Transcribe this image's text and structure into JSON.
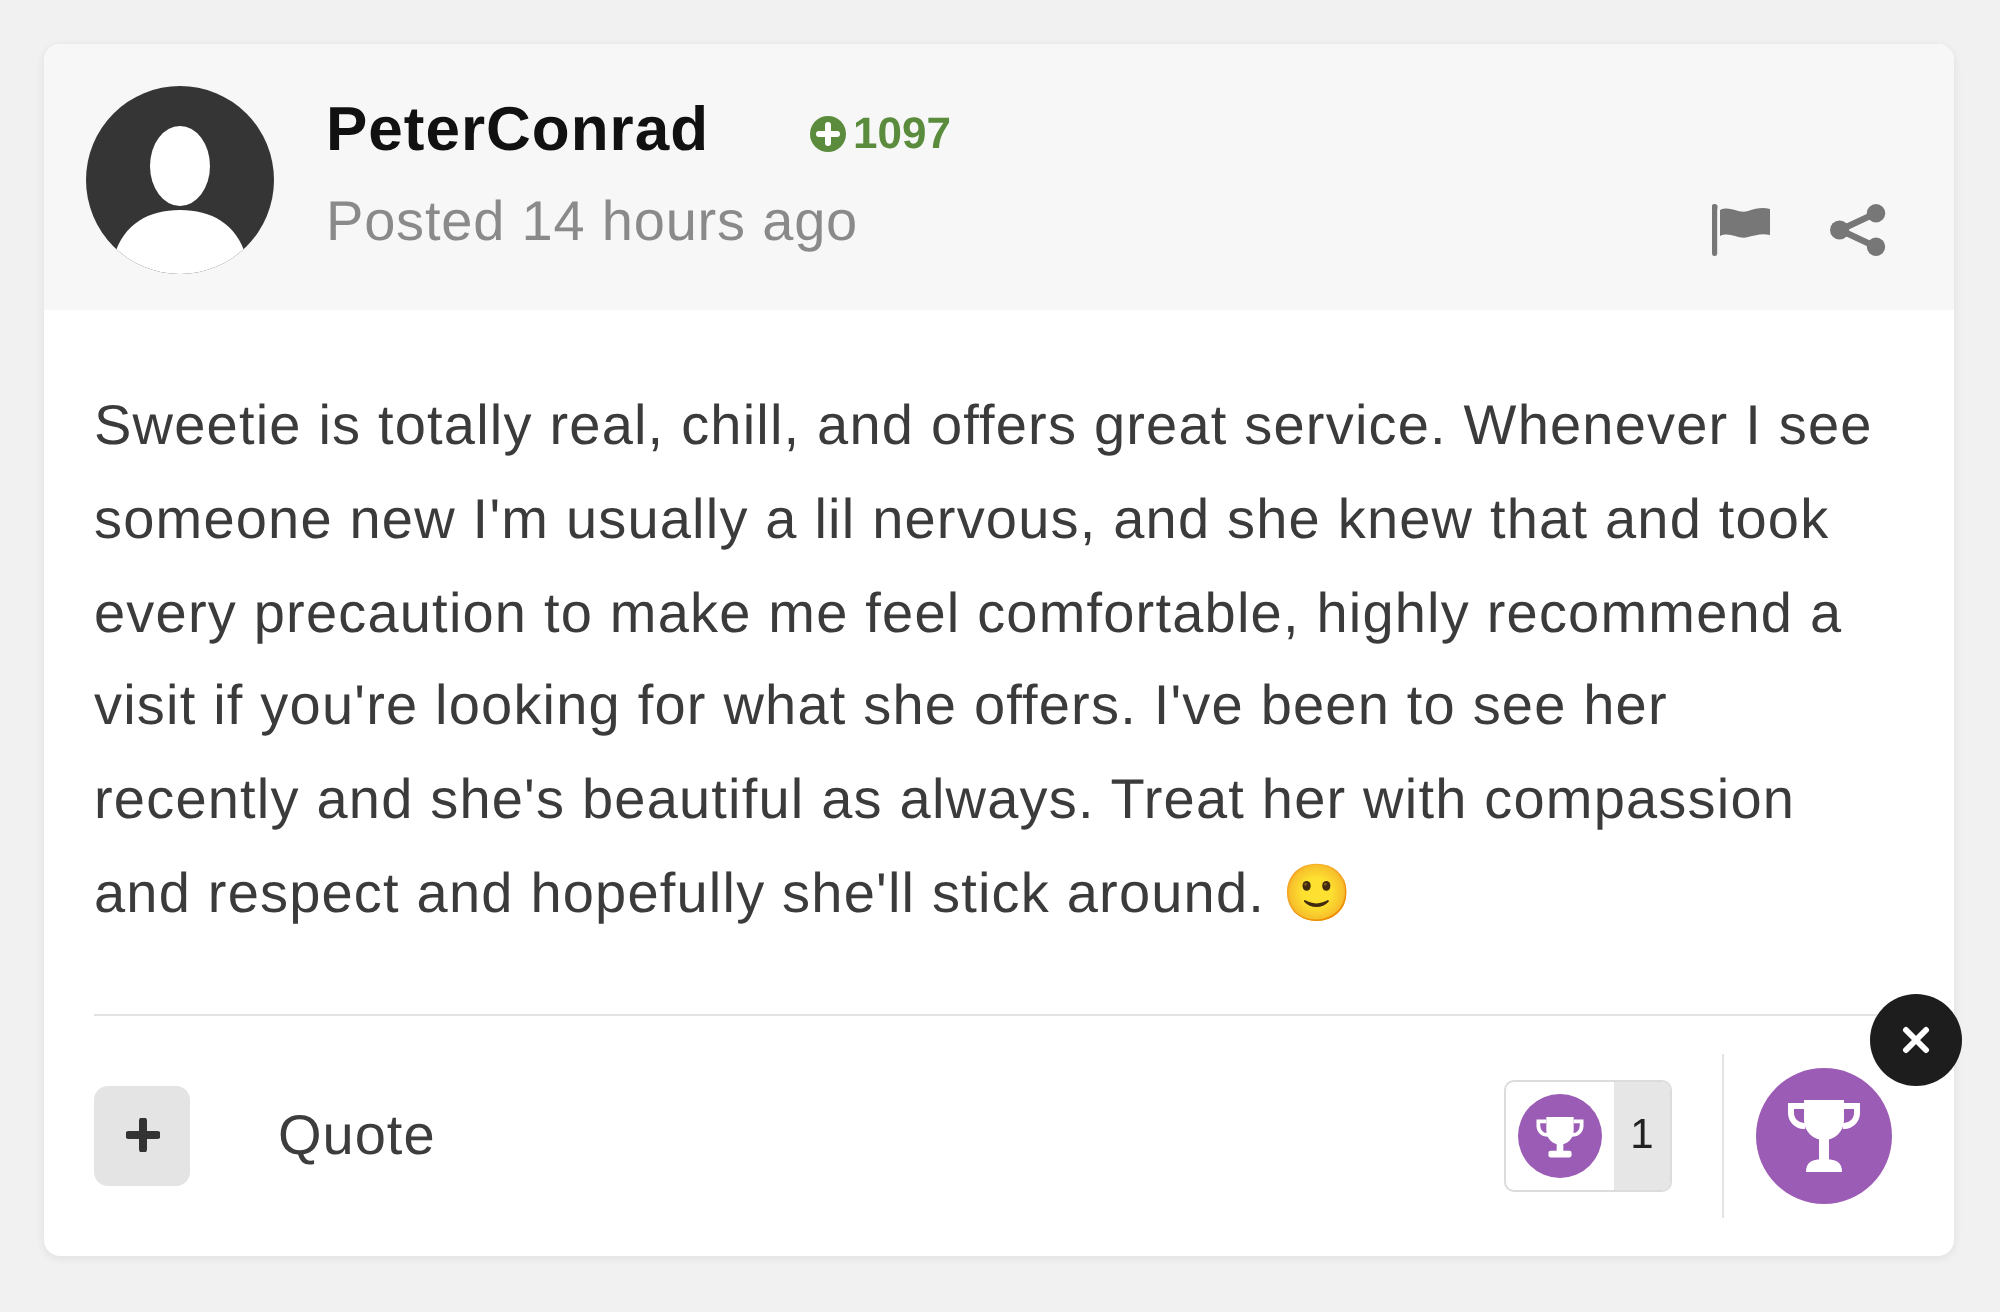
{
  "post": {
    "author": {
      "name": "PeterConrad",
      "reputation": "1097"
    },
    "posted": "Posted 14 hours ago",
    "body": "Sweetie is totally real, chill, and offers great service. Whenever I see someone new I'm usually a lil nervous, and she knew that and took every precaution to make me feel comfortable, highly recommend a visit if you're looking for what she offers. I've been to see her recently and she's beautiful as always. Treat her with compassion and respect and hopefully she'll stick around. 🙂",
    "footer": {
      "quote": "Quote",
      "reaction_count": "1"
    }
  }
}
